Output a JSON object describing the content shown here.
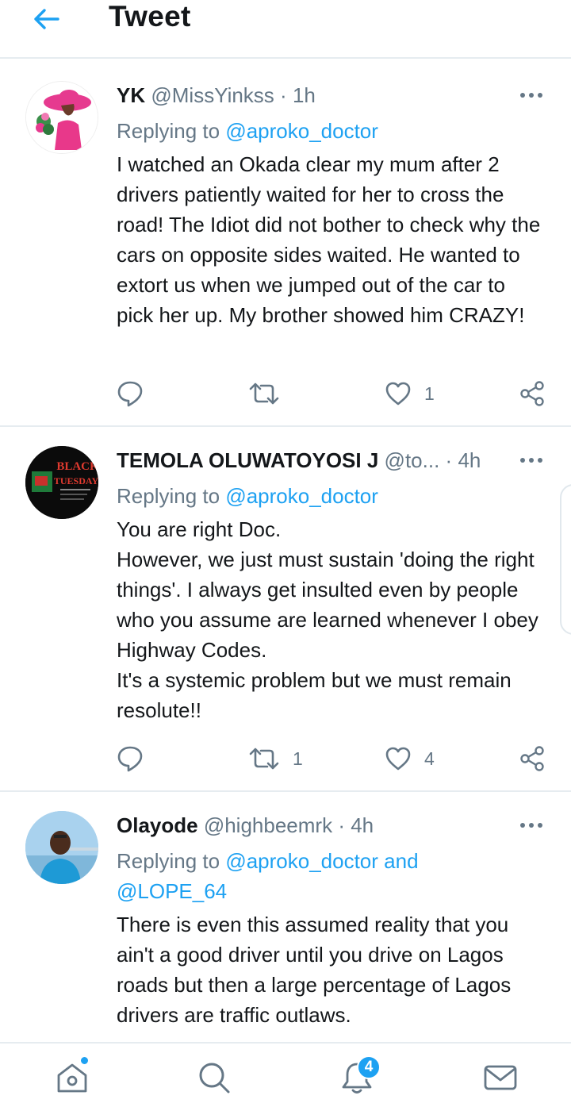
{
  "header": {
    "title": "Tweet"
  },
  "tweets": [
    {
      "name": "YK",
      "handle": "@MissYinkss",
      "dot": "·",
      "time": "1h",
      "replying_prefix": "Replying to",
      "replying_to": "@aproko_doctor",
      "replying_to_2": "",
      "text": "I watched an Okada clear my mum after 2 drivers patiently waited for her to cross the road! The Idiot did not bother to check why the cars on opposite sides waited. He wanted to extort us when we jumped out of the car to pick her up. My brother showed him CRAZY!",
      "reply_count": "",
      "retweet_count": "",
      "like_count": "1"
    },
    {
      "name": "TEMOLA OLUWATOYOSI J",
      "handle": "@to...",
      "dot": "·",
      "time": "4h",
      "replying_prefix": "Replying to",
      "replying_to": "@aproko_doctor",
      "replying_to_2": "",
      "text": "You are right Doc.\nHowever, we just must sustain 'doing the right things'. I always get insulted even by people who you assume are learned whenever I obey Highway Codes.\nIt's a systemic problem but we must remain resolute!!",
      "avatar_text_1": "BLACK",
      "avatar_text_2": "TUESDAY",
      "reply_count": "",
      "retweet_count": "1",
      "like_count": "4"
    },
    {
      "name": "Olayode",
      "handle": "@highbeemrk",
      "dot": "·",
      "time": "4h",
      "replying_prefix": "Replying to",
      "replying_to": "@aproko_doctor and",
      "replying_to_2": "@LOPE_64",
      "text": "There is even this assumed reality that you ain't a good driver until you drive on Lagos roads but then a large percentage of Lagos drivers are traffic outlaws.",
      "reply_count": "",
      "retweet_count": "",
      "like_count": ""
    }
  ],
  "nav": {
    "notification_badge": "4"
  },
  "colors": {
    "accent": "#1da1f2",
    "secondary_text": "#657786",
    "divider": "#e6ecf0"
  },
  "icons": [
    "back-arrow-icon",
    "more-icon",
    "reply-icon",
    "retweet-icon",
    "like-icon",
    "share-icon",
    "home-icon",
    "search-icon",
    "notifications-icon",
    "messages-icon"
  ]
}
